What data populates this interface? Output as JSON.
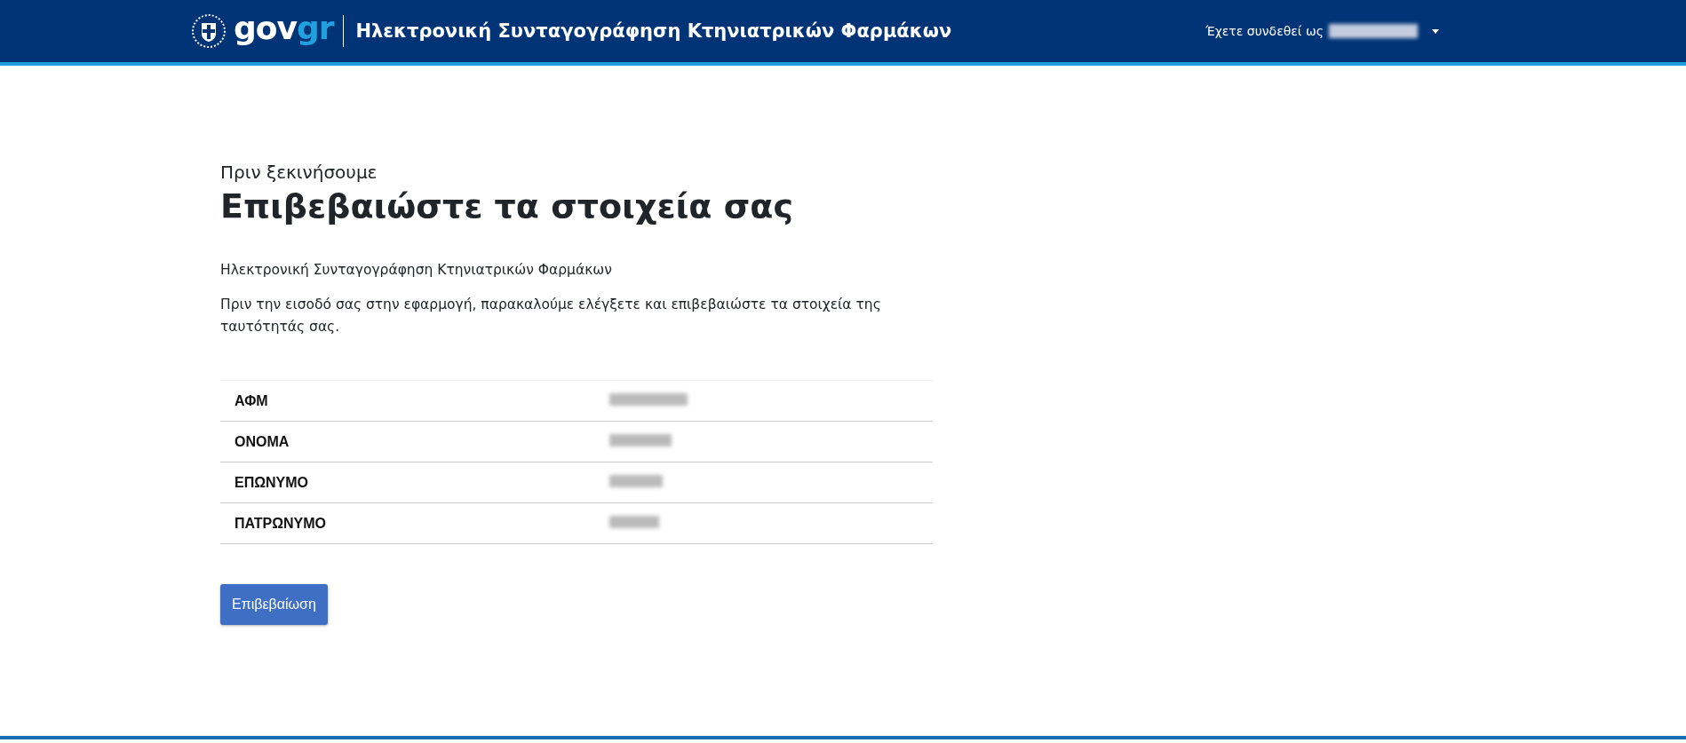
{
  "header": {
    "logo": {
      "part_1": "gov",
      "part_2": "gr"
    },
    "title": "Ηλεκτρονική Συνταγογράφηση Κτηνιατρικών Φαρμάκων",
    "user_label": "Έχετε συνδεθεί ως"
  },
  "content": {
    "eyebrow": "Πριν ξεκινήσουμε",
    "heading": "Επιβεβαιώστε τα στοιχεία σας",
    "app_name": "Ηλεκτρονική Συνταγογράφηση Κτηνιατρικών Φαρμάκων",
    "instructions": "Πριν την εισοδό σας στην εφαρμογή, παρακαλούμε ελέγξετε και επιβεβαιώστε τα στοιχεία της ταυτότητάς σας.",
    "rows": [
      {
        "label": "ΑΦΜ"
      },
      {
        "label": "ΟΝΟΜΑ"
      },
      {
        "label": "ΕΠΩΝΥΜΟ"
      },
      {
        "label": "ΠΑΤΡΩΝΥΜΟ"
      }
    ],
    "button": "Επιβεβαίωση"
  }
}
